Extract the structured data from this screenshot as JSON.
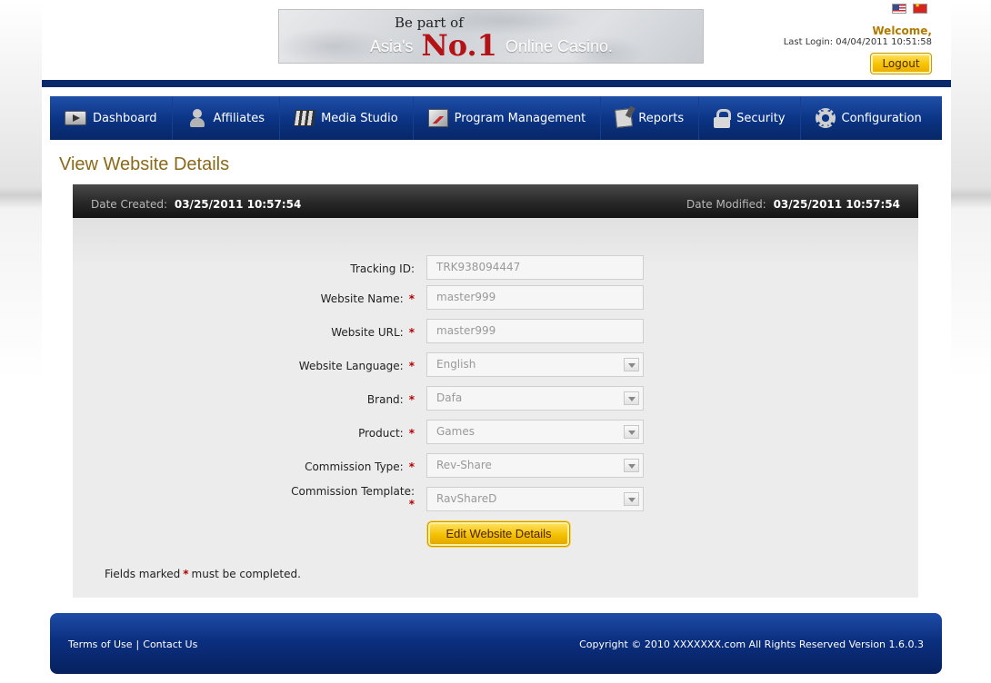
{
  "header": {
    "banner": {
      "line1": "Be part of",
      "line2_pre": "Asia's",
      "line2_no": "No.1",
      "line2_post": "Online Casino."
    },
    "flags": [
      "us-flag-icon",
      "cn-flag-icon"
    ],
    "welcome": "Welcome,",
    "last_login": "Last Login: 04/04/2011 10:51:58",
    "logout_label": "Logout"
  },
  "nav": {
    "items": [
      {
        "label": "Dashboard",
        "icon": "dashboard-icon"
      },
      {
        "label": "Affiliates",
        "icon": "affiliates-icon"
      },
      {
        "label": "Media Studio",
        "icon": "clapperboard-icon"
      },
      {
        "label": "Program Management",
        "icon": "chart-icon"
      },
      {
        "label": "Reports",
        "icon": "notepad-icon"
      },
      {
        "label": "Security",
        "icon": "lock-icon"
      },
      {
        "label": "Configuration",
        "icon": "gear-icon"
      }
    ]
  },
  "main": {
    "title": "View Website Details",
    "date_created_label": "Date Created:",
    "date_created": "03/25/2011 10:57:54",
    "date_modified_label": "Date Modified:",
    "date_modified": "03/25/2011 10:57:54",
    "form": {
      "tracking_id_label": "Tracking ID:",
      "tracking_id": "TRK938094447",
      "website_name_label": "Website Name:",
      "website_name": "master999",
      "website_url_label": "Website URL:",
      "website_url": "master999",
      "website_language_label": "Website Language:",
      "website_language": "English",
      "brand_label": "Brand:",
      "brand": "Dafa",
      "product_label": "Product:",
      "product": "Games",
      "commission_type_label": "Commission Type:",
      "commission_type": "Rev-Share",
      "commission_template_label": "Commission Template:",
      "commission_template": "RavShareD",
      "required_mark": "*"
    },
    "edit_button_label": "Edit Website Details",
    "note_pre": "Fields marked",
    "note_post": "must be completed."
  },
  "footer": {
    "terms": "Terms of Use",
    "separator": "|",
    "contact": "Contact Us",
    "copyright": "Copyright © 2010 XXXXXXX.com All Rights Reserved  Version 1.6.0.3"
  },
  "colors": {
    "nav_blue": "#0c3587",
    "title_gold": "#8a6a1a",
    "button_yellow": "#f4c000",
    "required_red": "#b30000"
  }
}
